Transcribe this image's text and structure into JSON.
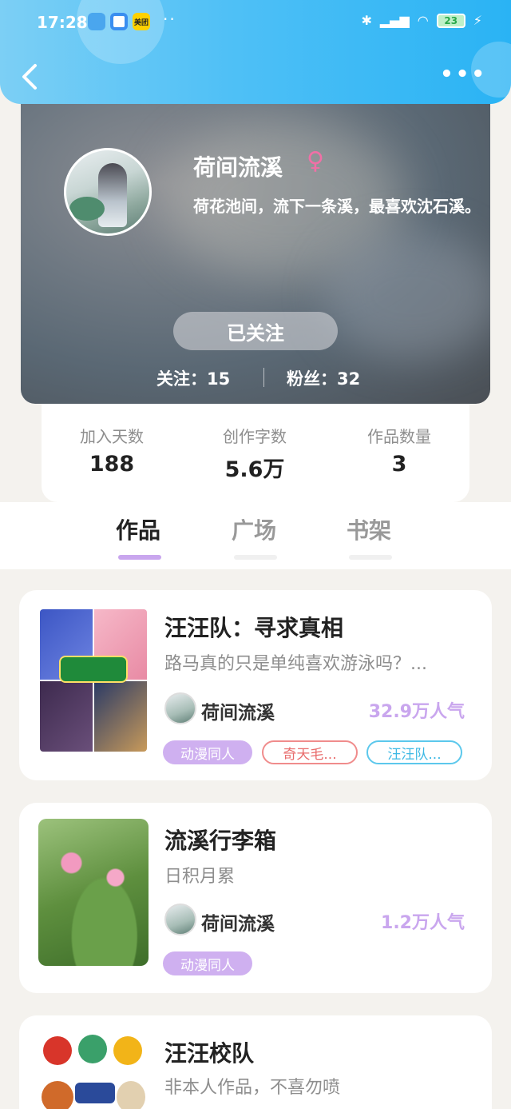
{
  "status_bar": {
    "time": "17:28",
    "app_badge": "美团",
    "battery": "23"
  },
  "header": {
    "back_icon": "chevron-left-icon",
    "more_icon": "more-dots-icon"
  },
  "profile": {
    "name": "荷间流溪",
    "gender_icon": "♀",
    "bio": "荷花池间，流下一条溪，最喜欢沈石溪。",
    "follow_button": "已关注",
    "following": "关注：15",
    "followers": "粉丝：32"
  },
  "stats": [
    {
      "label": "加入天数",
      "value": "188"
    },
    {
      "label": "创作字数",
      "value": "5.6万"
    },
    {
      "label": "作品数量",
      "value": "3"
    }
  ],
  "tabs": [
    {
      "label": "作品",
      "active": true
    },
    {
      "label": "广场",
      "active": false
    },
    {
      "label": "书架",
      "active": false
    }
  ],
  "works": [
    {
      "title": "汪汪队：寻求真相",
      "description": "路马真的只是单纯喜欢游泳吗？...",
      "author": "荷间流溪",
      "popularity": "32.9万人气",
      "tags": [
        "动漫同人",
        "奇天毛...",
        "汪汪队..."
      ]
    },
    {
      "title": "流溪行李箱",
      "description": "日积月累",
      "author": "荷间流溪",
      "popularity": "1.2万人气",
      "tags": [
        "动漫同人"
      ]
    },
    {
      "title": "汪汪校队",
      "description": "非本人作品，不喜勿喷"
    }
  ],
  "colors": {
    "accent": "#c9a6ee",
    "topbar": "#2ab3f4",
    "tag_red": "#e86a6a",
    "tag_blue": "#3cb8e4"
  }
}
